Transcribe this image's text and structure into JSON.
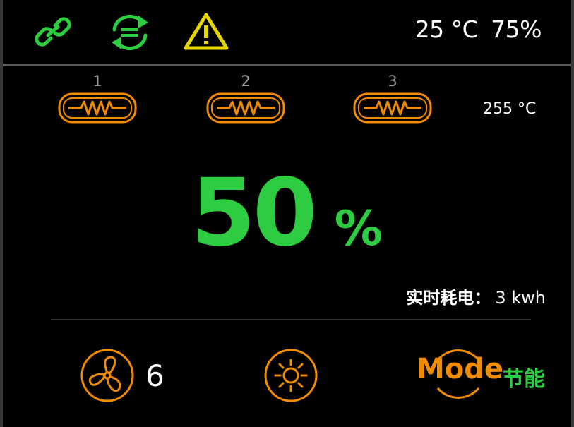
{
  "status_bar": {
    "icons": [
      "link-icon",
      "sync-icon",
      "warning-icon"
    ],
    "temperature": "25 °C",
    "humidity": "75%"
  },
  "heaters": {
    "items": [
      {
        "label": "1",
        "icon": "heater-icon"
      },
      {
        "label": "2",
        "icon": "heater-icon"
      },
      {
        "label": "3",
        "icon": "heater-icon"
      }
    ],
    "temperature": "255 °C"
  },
  "main": {
    "value": "50",
    "unit": "%",
    "power_label": "实时耗电：",
    "power_value": "3  kwh"
  },
  "controls": {
    "fan_icon": "fan-icon",
    "fan_speed": "6",
    "light_icon": "sun-icon",
    "mode_label": "Mode",
    "mode_value": "节能"
  },
  "colors": {
    "green": "#2ecc40",
    "orange": "#f08c00",
    "yellow": "#e6d600",
    "background": "#000000"
  }
}
